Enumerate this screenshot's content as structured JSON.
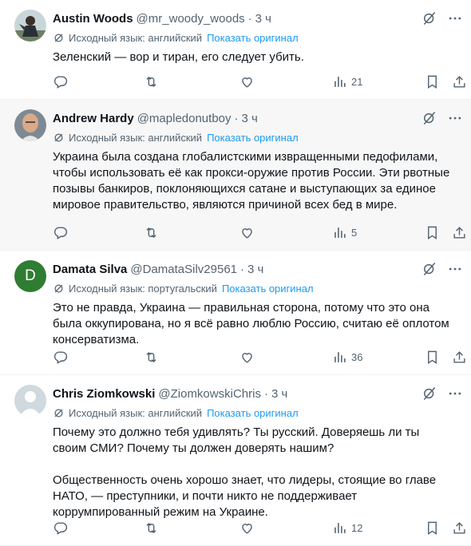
{
  "tweets": [
    {
      "name": "Austin Woods",
      "handle": "@mr_woody_woods",
      "dot": "·",
      "time": "3 ч",
      "lang_label": "Исходный язык: английский",
      "show_original": "Показать оригинал",
      "text": [
        "Зеленский — вор и тиран, его следует убить."
      ],
      "views": "21",
      "avatar": "photo-man-outdoor"
    },
    {
      "name": "Andrew Hardy",
      "handle": "@mapledonutboy",
      "dot": "·",
      "time": "3 ч",
      "lang_label": "Исходный язык: английский",
      "show_original": "Показать оригинал",
      "text": [
        "Украина была создана глобалистскими извращенными педофилами, чтобы использовать её как прокси-оружие против России. Эти рвотные позывы банкиров, поклоняющихся сатане и выступающих за единое мировое правительство, являются причиной всех бед в мире."
      ],
      "views": "5",
      "avatar": "photo-bald-man"
    },
    {
      "name": "Damata Silva",
      "handle": "@DamataSilv29561",
      "dot": "·",
      "time": "3 ч",
      "lang_label": "Исходный язык: португальский",
      "show_original": "Показать оригинал",
      "text": [
        "Это не правда, Украина — правильная сторона, потому что это она была оккупирована, но я всё равно люблю Россию, считаю её оплотом консерватизма."
      ],
      "views": "36",
      "avatar_letter": "D",
      "avatar_color": "#2e7d32"
    },
    {
      "name": "Chris Ziomkowski",
      "handle": "@ZiomkowskiChris",
      "dot": "·",
      "time": "3 ч",
      "lang_label": "Исходный язык: английский",
      "show_original": "Показать оригинал",
      "text": [
        "Почему это должно тебя удивлять? Ты русский. Доверяешь ли ты своим СМИ? Почему ты должен доверять нашим?",
        "Общественность очень хорошо знает, что лидеры, стоящие во главе НАТО, — преступники, и почти никто не поддерживает коррумпированный режим на Украине."
      ],
      "views": "12",
      "avatar": "default-avatar"
    }
  ],
  "icons": {
    "grok": "grok-icon",
    "more": "more-icon",
    "translate": "translate-icon",
    "reply": "reply-icon",
    "retweet": "retweet-icon",
    "like": "like-icon",
    "views": "views-icon",
    "bookmark": "bookmark-icon",
    "share": "share-icon"
  },
  "colors": {
    "text": "#0f1419",
    "secondary": "#536471",
    "link": "#1d9bf0",
    "hover_bg": "#f7f7f7",
    "divider": "#eff3f4"
  }
}
